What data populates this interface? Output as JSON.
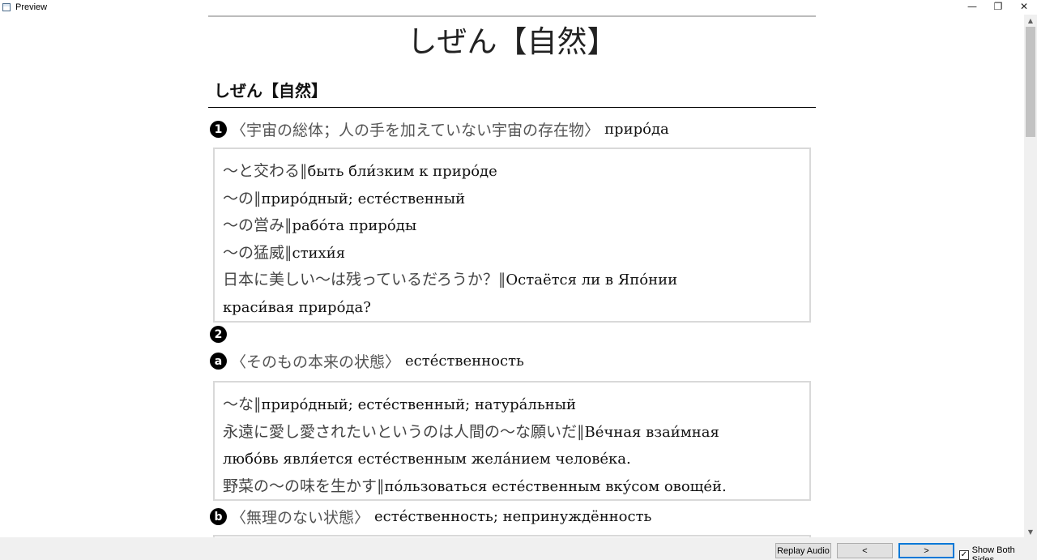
{
  "window": {
    "title": "Preview",
    "controls": {
      "minimize": "—",
      "restore": "❐",
      "close": "✕"
    }
  },
  "card": {
    "front": "しぜん【自然】",
    "back_heading": "しぜん【自然】",
    "senses": [
      {
        "badge": "1",
        "gloss": "〈宇宙の総体；人の手を加えていない宇宙の存在物〉",
        "translation": "приро́да",
        "examples": [
          {
            "jp": "〜と交わる∥",
            "ru": "быть бли́зким к приро́де"
          },
          {
            "jp": "〜の∥",
            "ru": "приро́дный; есте́ственный"
          },
          {
            "jp": "〜の営み∥",
            "ru": "рабо́та приро́ды"
          },
          {
            "jp": "〜の猛威∥",
            "ru": "стихи́я"
          },
          {
            "jp": "日本に美しい〜は残っているだろうか？∥",
            "ru": "Остаётся ли в Япо́нии"
          },
          {
            "jp": "",
            "ru": "краси́вая приро́да?"
          }
        ]
      },
      {
        "badge": "2",
        "gloss": "",
        "translation": ""
      },
      {
        "badge": "a",
        "gloss": "〈そのもの本来の状態〉",
        "translation": "есте́ственность",
        "examples": [
          {
            "jp": "〜な∥",
            "ru": "приро́дный; есте́ственный; натура́льный"
          },
          {
            "jp": "永遠に愛し愛されたいというのは人間の〜な願いだ∥",
            "ru": "Ве́чная взаи́мная"
          },
          {
            "jp": "",
            "ru": "любо́вь явля́ется есте́ственным жела́нием челове́ка."
          },
          {
            "jp": "野菜の〜の味を生かす∥",
            "ru": "по́льзоваться есте́ственным вку́сом овоще́й."
          }
        ]
      },
      {
        "badge": "b",
        "gloss": "〈無理のない状態〉",
        "translation": "есте́ственность; непринуждённость"
      }
    ]
  },
  "scrollbar": {
    "up_arrow": "▲",
    "down_arrow": "▼"
  },
  "bottom_bar": {
    "replay_audio": "Replay Audio",
    "prev": "<",
    "next": ">",
    "show_both_sides_label": "Show Both Sides",
    "show_both_sides_checked": "✓"
  },
  "colors": {
    "focus_border": "#0078d7",
    "box_border": "#d9d9d9",
    "gloss_text": "#555555"
  }
}
